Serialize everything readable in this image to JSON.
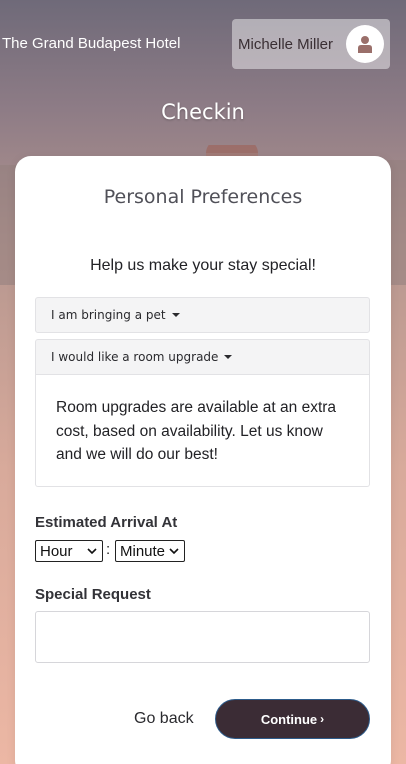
{
  "header": {
    "hotel_name": "The Grand Budapest Hotel",
    "user_name": "Michelle Miller",
    "page_title": "Checkin"
  },
  "card": {
    "title": "Personal Preferences",
    "subtitle": "Help us make your stay special!",
    "pet_toggle_label": "I am bringing a pet",
    "upgrade_toggle_label": "I would like a room upgrade",
    "upgrade_info": "Room upgrades are available at an extra cost, based on availability. Let us know and we will do our best!",
    "arrival_label": "Estimated Arrival At",
    "hour_select_value": "Hour",
    "time_separator": ":",
    "minute_select_value": "Minute",
    "request_label": "Special Request",
    "request_value": "",
    "go_back_label": "Go back",
    "continue_label": "Continue",
    "continue_arrow": "›"
  },
  "colors": {
    "primary_button": "#3b2c35",
    "background_top": "#6f6a79",
    "background_bottom": "#ecb7a4",
    "avatar_icon": "#9a6f6a"
  },
  "icons": {
    "avatar": "user-icon",
    "dropdown": "caret-down-icon",
    "select": "chevron-down-icon",
    "continue": "chevron-right-icon"
  }
}
